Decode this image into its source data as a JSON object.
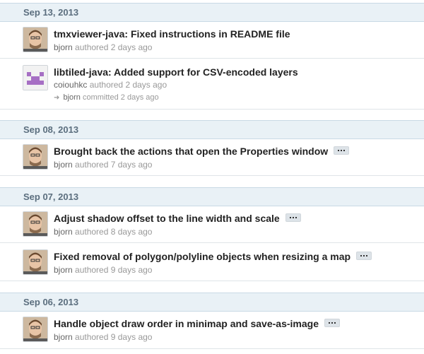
{
  "groups": [
    {
      "date": "Sep 13, 2013",
      "commits": [
        {
          "message": "tmxviewer-java: Fixed instructions in README file",
          "author": "bjorn",
          "action": "authored",
          "time": "2 days ago"
        },
        {
          "message": "libtiled-java: Added support for CSV-encoded layers",
          "author": "coiouhkc",
          "action": "authored",
          "time": "2 days ago",
          "committer": "bjorn",
          "committer_action": "committed",
          "committer_time": "2 days ago",
          "avatar": "identicon"
        }
      ]
    },
    {
      "date": "Sep 08, 2013",
      "commits": [
        {
          "message": "Brought back the actions that open the Properties window",
          "author": "bjorn",
          "action": "authored",
          "time": "7 days ago"
        }
      ]
    },
    {
      "date": "Sep 07, 2013",
      "commits": [
        {
          "message": "Adjust shadow offset to the line width and scale",
          "author": "bjorn",
          "action": "authored",
          "time": "8 days ago"
        },
        {
          "message": "Fixed removal of polygon/polyline objects when resizing a map",
          "author": "bjorn",
          "action": "authored",
          "time": "9 days ago"
        }
      ]
    },
    {
      "date": "Sep 06, 2013",
      "commits": [
        {
          "message": "Handle object draw order in minimap and save-as-image",
          "author": "bjorn",
          "action": "authored",
          "time": "9 days ago"
        }
      ]
    }
  ],
  "icons": {
    "expand": "ellipsis-icon",
    "committer_arrow": "arrow-right-icon"
  },
  "colors": {
    "header_bg": "#e9f1f6",
    "identicon": "#a66fc4"
  }
}
